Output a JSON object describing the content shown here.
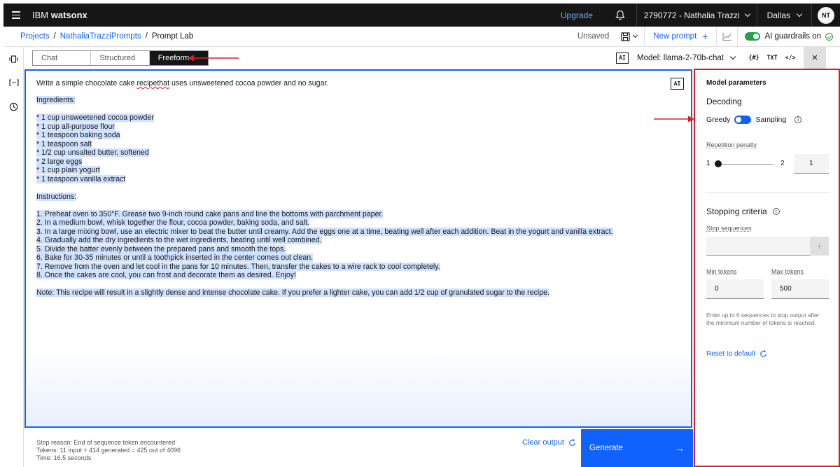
{
  "app": {
    "brand_prefix": "IBM",
    "brand_name": "watsonx"
  },
  "topbar": {
    "upgrade_label": "Upgrade",
    "account_label": "2790772 - Nathalia Trazzi",
    "region_label": "Dallas",
    "avatar_initials": "NT"
  },
  "breadcrumb": {
    "items": [
      "Projects",
      "NathaliaTrazziPrompts",
      "Prompt Lab"
    ],
    "separator": "/"
  },
  "header": {
    "status": "Unsaved",
    "new_prompt_label": "New prompt",
    "plus_glyph": "+",
    "guardrails_label": "AI guardrails on",
    "guardrails_on": true
  },
  "mode_tabs": {
    "items": [
      "Chat",
      "Structured",
      "Freeform"
    ],
    "active": "Freeform"
  },
  "model_bar": {
    "ai_badge": "AI",
    "model_label": "Model: llama-2-70b-chat",
    "tool_variables": "{#}",
    "tool_txt": "TXT",
    "tool_code": "</>",
    "close_glyph": "×"
  },
  "editor": {
    "ai_badge": "AI",
    "prompt_before": "Write a simple chocolate cake ",
    "prompt_typo": "recipethat",
    "prompt_after": " uses unsweetened cocoa powder and no sugar.",
    "output_lines": [
      "Ingredients:",
      "",
      "* 1 cup unsweetened cocoa powder",
      "* 1 cup all-purpose flour",
      "* 1 teaspoon baking soda",
      "* 1 teaspoon salt",
      "* 1/2 cup unsalted butter, softened",
      "* 2 large eggs",
      "* 1 cup plain yogurt",
      "* 1 teaspoon vanilla extract",
      "",
      "Instructions:",
      "",
      "1. Preheat oven to 350°F. Grease two 9-inch round cake pans and line the bottoms with parchment paper.",
      "2. In a medium bowl, whisk together the flour, cocoa powder, baking soda, and salt.",
      "3. In a large mixing bowl, use an electric mixer to beat the butter until creamy. Add the eggs one at a time, beating well after each addition. Beat in the yogurt and vanilla extract.",
      "4. Gradually add the dry ingredients to the wet ingredients, beating until well combined.",
      "5. Divide the batter evenly between the prepared pans and smooth the tops.",
      "6. Bake for 30-35 minutes or until a toothpick inserted in the center comes out clean.",
      "7. Remove from the oven and let cool in the pans for 10 minutes. Then, transfer the cakes to a wire rack to cool completely.",
      "8. Once the cakes are cool, you can frost and decorate them as desired. Enjoy!",
      "",
      "Note: This recipe will result in a slightly dense and intense chocolate cake. If you prefer a lighter cake, you can add 1/2 cup of granulated sugar to the recipe."
    ]
  },
  "footer": {
    "stop_reason": "Stop reason: End of sequence token encountered",
    "tokens": "Tokens: 11 input + 414 generated = 425 out of 4096",
    "time": "Time: 16.5 seconds",
    "clear_label": "Clear output",
    "generate_label": "Generate",
    "generate_arrow": "→"
  },
  "params": {
    "title": "Model parameters",
    "decoding_heading": "Decoding",
    "greedy_label": "Greedy",
    "sampling_label": "Sampling",
    "info_glyph": "i",
    "repetition_label": "Repetition penalty",
    "slider_min": "1",
    "slider_max": "2",
    "repetition_value": "1",
    "stopping_heading": "Stopping criteria",
    "stop_sequences_label": "Stop sequences",
    "add_glyph": "+",
    "min_tokens_label": "Min tokens",
    "max_tokens_label": "Max tokens",
    "min_tokens_value": "0",
    "max_tokens_value": "500",
    "hint": "Enter up to 6 sequences to stop output after the minimum number of tokens is reached.",
    "reset_label": "Reset to default"
  },
  "colors": {
    "accent": "#0f62fe",
    "highlight": "#d0e2ff",
    "annotation_red": "#da1e28",
    "topbar": "#161616",
    "success": "#24a148"
  }
}
